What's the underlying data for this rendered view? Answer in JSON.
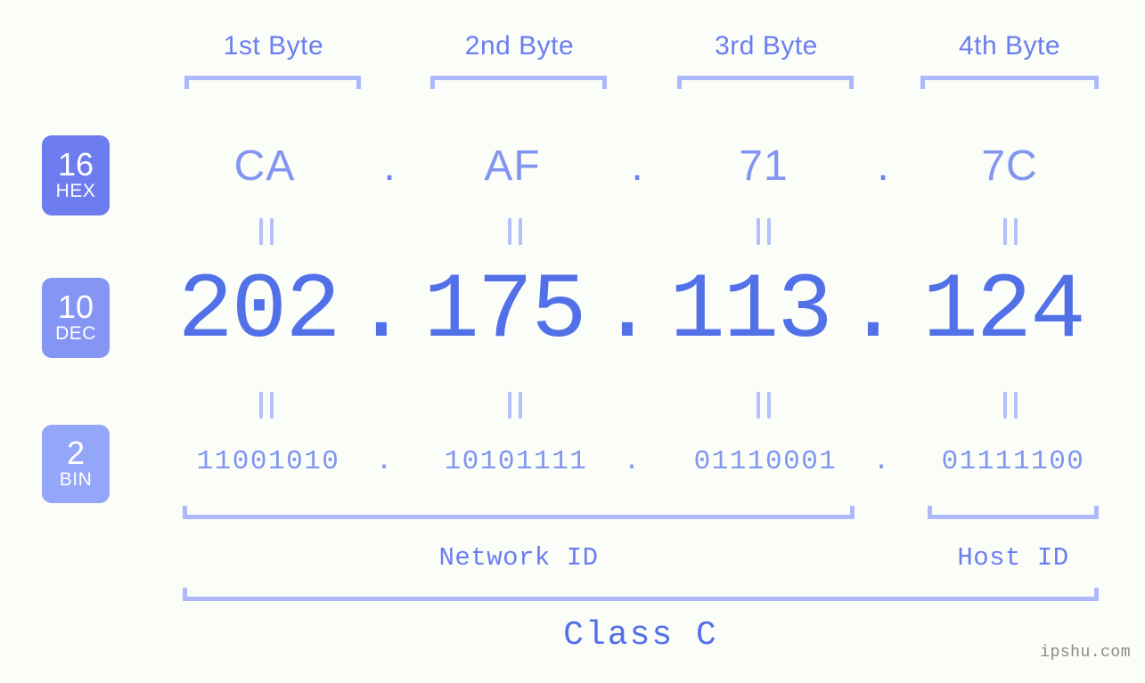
{
  "background_color": "#fbfdf8",
  "colors": {
    "bracket": "#adb9fb",
    "header_text": "#6b7ef0",
    "hex_text": "#8295f0",
    "dec_text": "#5271e8",
    "bin_text": "#8295f0",
    "badge_hex_bg": "#6d7df0",
    "badge_dec_bg": "#8495f3",
    "badge_bin_bg": "#94a6f7",
    "equals_mark": "#b5c0fb",
    "watermark_text": "#8a8a8a"
  },
  "byte_headers": [
    {
      "label": "1st Byte"
    },
    {
      "label": "2nd Byte"
    },
    {
      "label": "3rd Byte"
    },
    {
      "label": "4th Byte"
    }
  ],
  "bases": [
    {
      "number": "16",
      "name": "HEX"
    },
    {
      "number": "10",
      "name": "DEC"
    },
    {
      "number": "2",
      "name": "BIN"
    }
  ],
  "rows": {
    "hex": {
      "base_number": "16",
      "base_name": "HEX",
      "octets": [
        "CA",
        "AF",
        "71",
        "7C"
      ],
      "separator": "."
    },
    "dec": {
      "base_number": "10",
      "base_name": "DEC",
      "octets": [
        "202",
        "175",
        "113",
        "124"
      ],
      "separator": ".",
      "full_value": "202.175.113.124"
    },
    "bin": {
      "base_number": "2",
      "base_name": "BIN",
      "octets": [
        "11001010",
        "10101111",
        "01110001",
        "01111100"
      ],
      "separator": "."
    }
  },
  "equals_marks": {
    "symbol": "=",
    "count_per_row": 4,
    "rows": 2
  },
  "sections": {
    "network_id": {
      "label": "Network ID"
    },
    "host_id": {
      "label": "Host ID"
    },
    "class": {
      "label": "Class C"
    }
  },
  "watermark": {
    "text": "ipshu.com"
  }
}
